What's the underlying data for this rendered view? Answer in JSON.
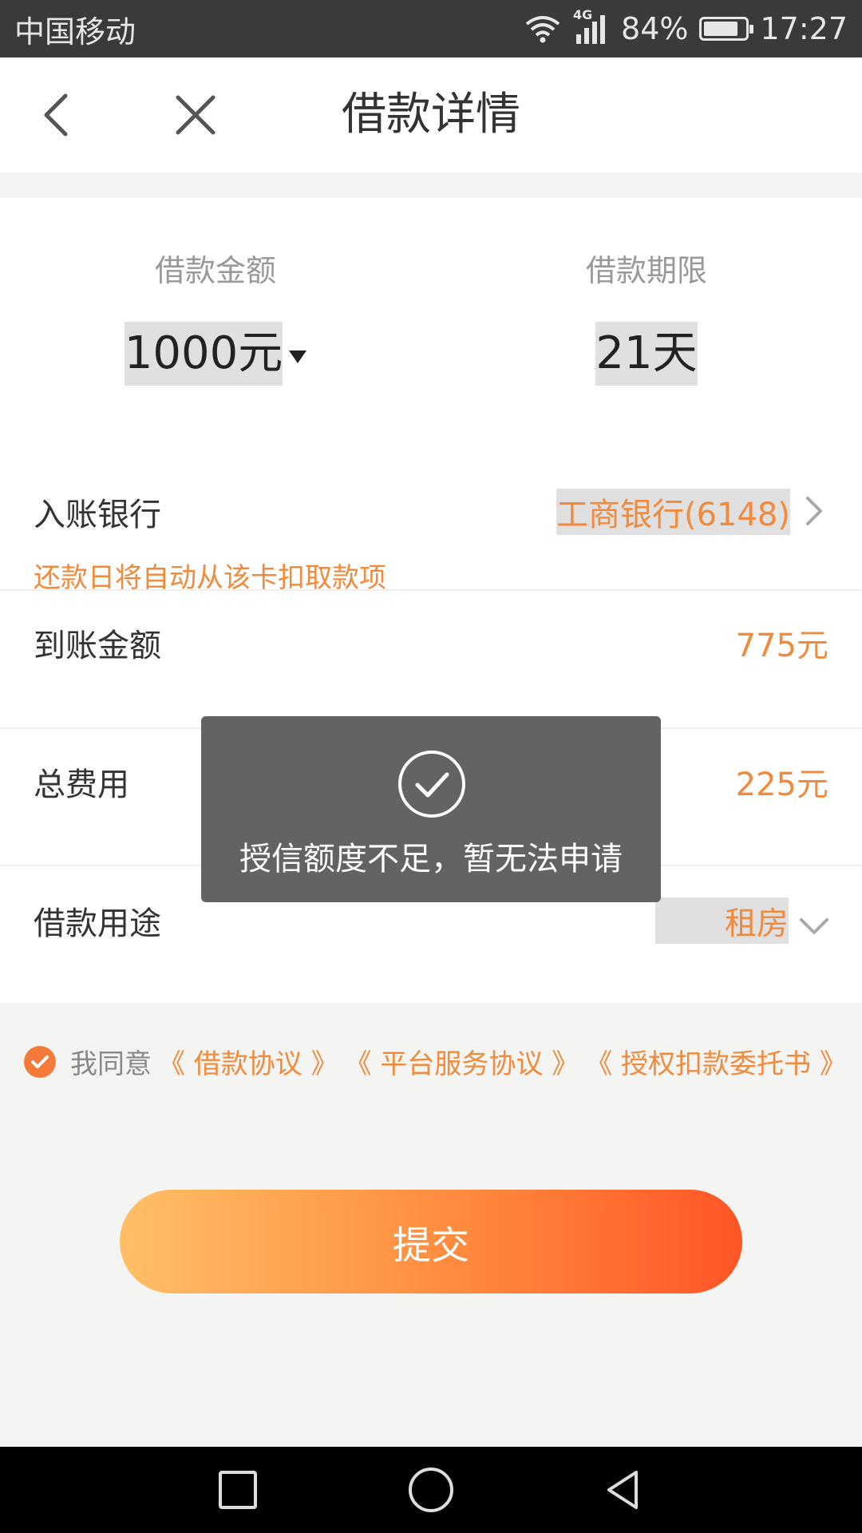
{
  "status_bar": {
    "carrier": "中国移动",
    "network": "4G",
    "battery": "84%",
    "battery_level": 0.84,
    "time": "17:27"
  },
  "header": {
    "title": "借款详情",
    "back_icon": "chevron-left-icon",
    "close_icon": "close-icon"
  },
  "summary": {
    "amount_label": "借款金额",
    "amount_value": "1000元",
    "term_label": "借款期限",
    "term_value": "21天"
  },
  "details": {
    "bank_label": "入账银行",
    "bank_value": "工商银行(6148)",
    "bank_hint": "还款日将自动从该卡扣取款项",
    "received_label": "到账金额",
    "received_value": "775元",
    "fee_label": "总费用",
    "fee_value": "225元",
    "purpose_label": "借款用途",
    "purpose_value": "租房"
  },
  "agreement": {
    "prefix": "我同意",
    "links": [
      "《 借款协议 》",
      "《 平台服务协议 》",
      "《 授权扣款委托书 》"
    ]
  },
  "submit_label": "提交",
  "toast": {
    "message": "授信额度不足，暂无法申请",
    "icon": "check-circle-icon"
  },
  "colors": {
    "accent": "#f08a3c",
    "button_start": "#ffbf66",
    "button_end": "#ff5526",
    "toast_bg": "#636363"
  }
}
